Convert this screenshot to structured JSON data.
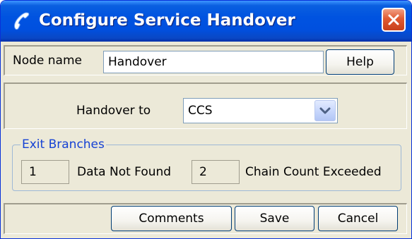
{
  "window": {
    "title": "Configure Service Handover"
  },
  "node": {
    "label": "Node name",
    "value": "Handover",
    "help_label": "Help"
  },
  "handover": {
    "label": "Handover to",
    "selected": "CCS"
  },
  "exit_branches": {
    "legend": "Exit Branches",
    "items": [
      {
        "number": "1",
        "label": "Data Not Found"
      },
      {
        "number": "2",
        "label": "Chain Count Exceeded"
      }
    ]
  },
  "footer": {
    "comments_label": "Comments",
    "save_label": "Save",
    "cancel_label": "Cancel"
  },
  "colors": {
    "titlebar": "#0053e0",
    "close": "#e05a32",
    "legend_text": "#1642d4",
    "dialog_bg": "#ece9d8"
  },
  "icons": {
    "title": "phone-handset-icon",
    "close": "close-icon",
    "dropdown": "chevron-down-icon"
  }
}
